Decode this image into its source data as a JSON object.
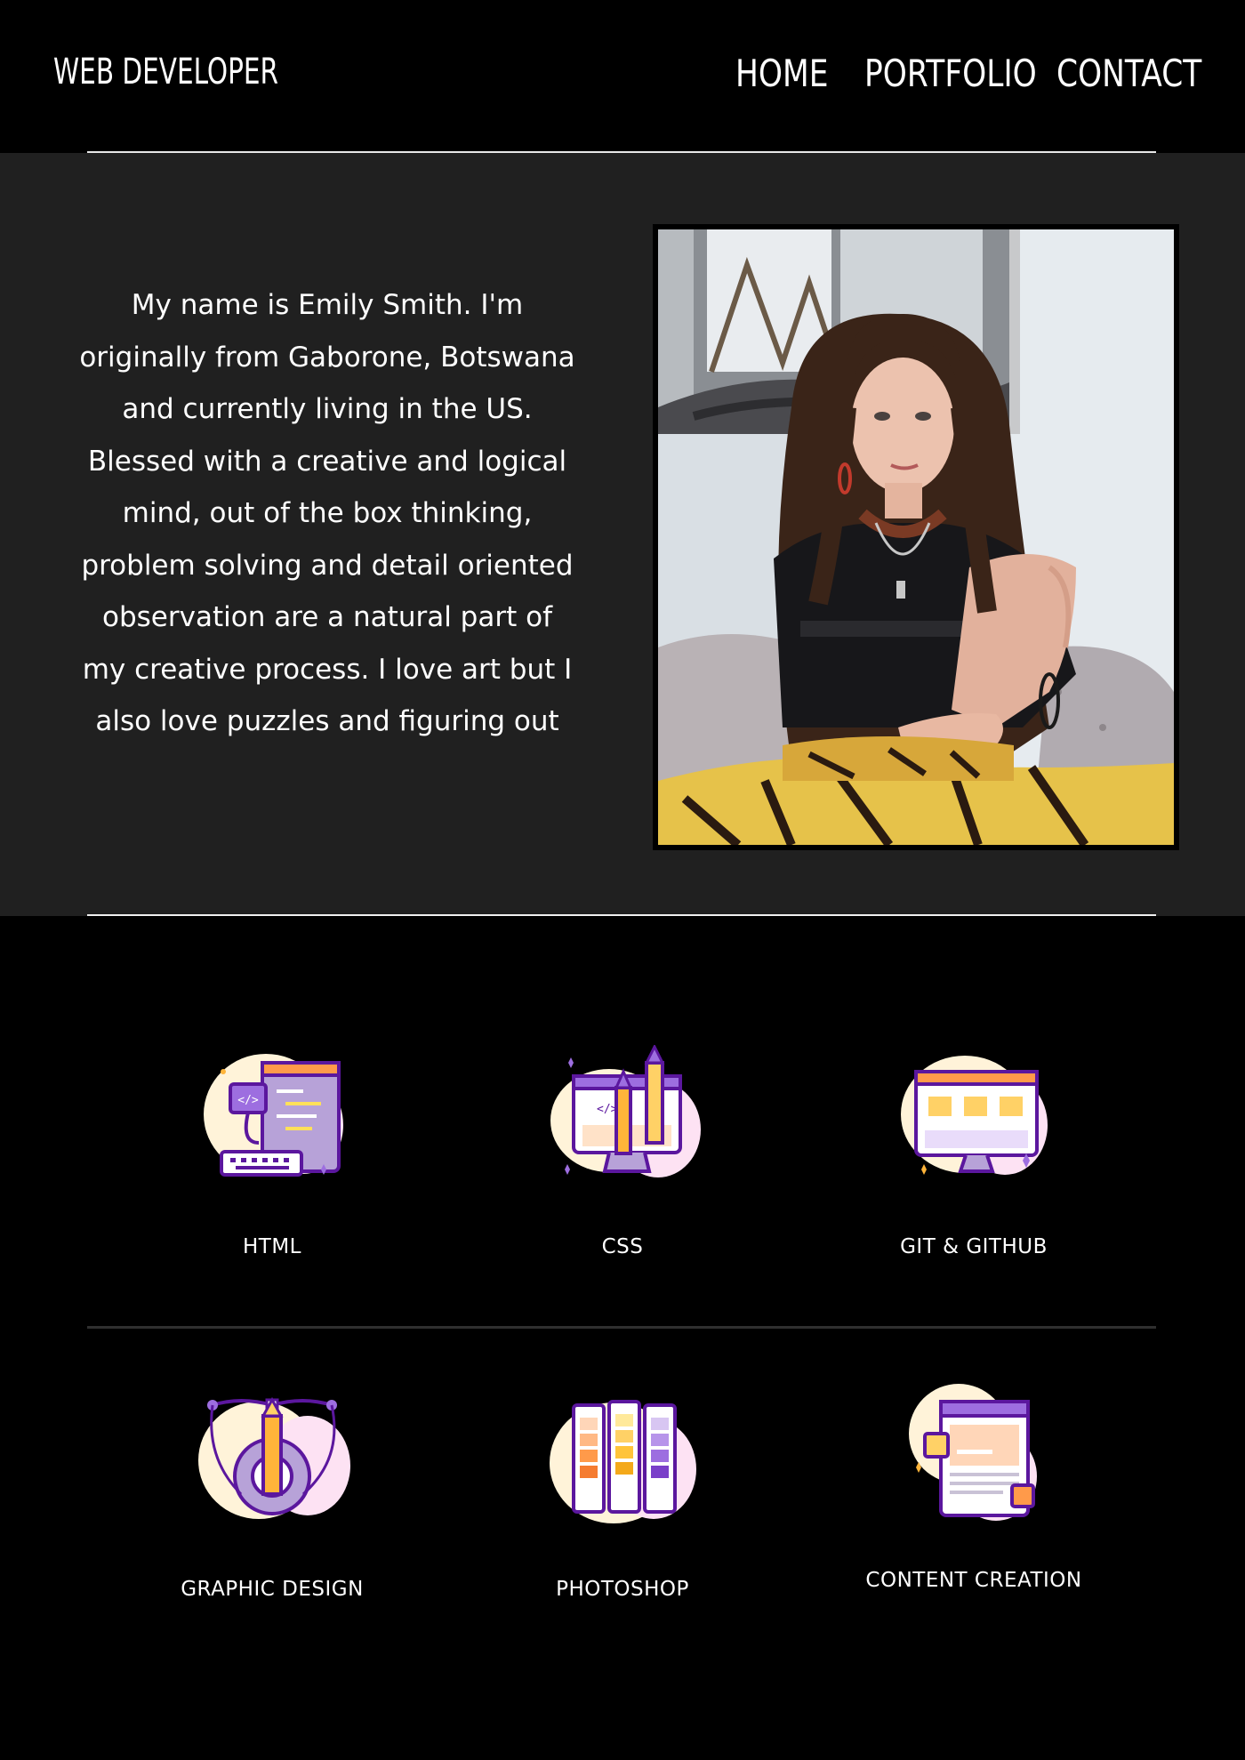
{
  "header": {
    "brand": "WEB DEVELOPER",
    "nav": [
      {
        "label": "HOME"
      },
      {
        "label": "PORTFOLIO"
      },
      {
        "label": "CONTACT"
      }
    ]
  },
  "about": {
    "bio": "My name is Emily Smith. I'm originally from Gaborone, Botswana and currently living in the US. Blessed with a creative and logical mind, out of the box thinking, problem solving and detail oriented observation are a natural part of my creative process. I love art but I also love puzzles and figuring out"
  },
  "skills": [
    {
      "label": "HTML",
      "icon": "html-code-icon"
    },
    {
      "label": "CSS",
      "icon": "css-design-icon"
    },
    {
      "label": "GIT & GITHUB",
      "icon": "git-github-icon"
    },
    {
      "label": "GRAPHIC DESIGN",
      "icon": "graphic-design-icon"
    },
    {
      "label": "PHOTOSHOP",
      "icon": "photoshop-palette-icon"
    },
    {
      "label": "CONTENT CREATION",
      "icon": "content-creation-icon"
    }
  ],
  "colors": {
    "header_bg": "#000000",
    "about_bg": "#202020",
    "accent_purple": "#6a1fb5",
    "accent_orange": "#f57c30",
    "accent_yellow": "#f7c948"
  }
}
